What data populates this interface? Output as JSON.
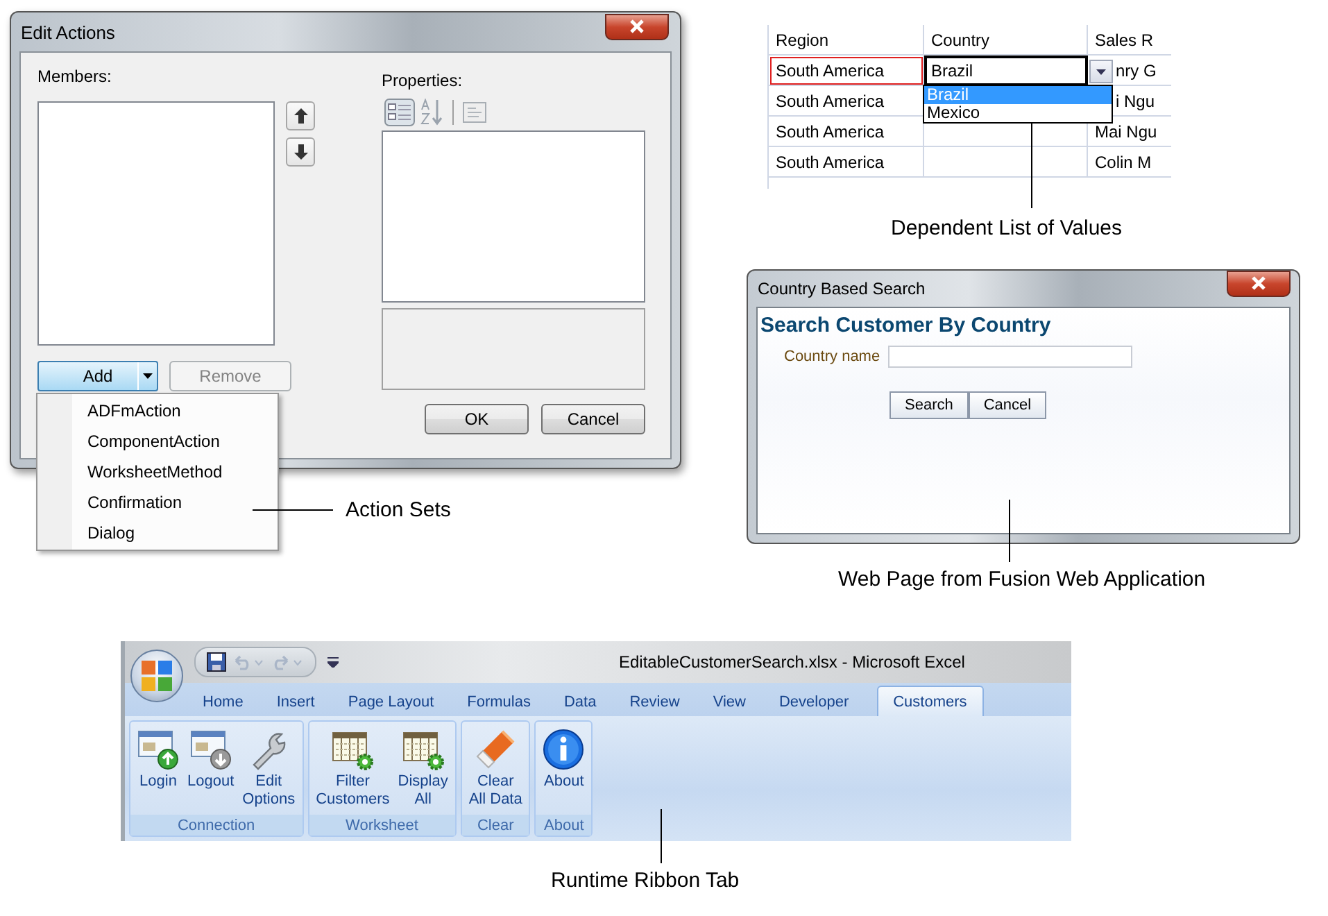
{
  "edit_actions": {
    "title": "Edit Actions",
    "members_label": "Members:",
    "properties_label": "Properties:",
    "add_button": "Add",
    "remove_button": {
      "label": "Remove",
      "disabled": true
    },
    "ok_button": "OK",
    "cancel_button": "Cancel",
    "menu": [
      {
        "label": "ADFmAction"
      },
      {
        "label": "ComponentAction"
      },
      {
        "label": "WorksheetMethod"
      },
      {
        "label": "Confirmation"
      },
      {
        "label": "Dialog"
      }
    ],
    "callout": "Action Sets"
  },
  "grid": {
    "columns": [
      "Region",
      "Country",
      "Sales R"
    ],
    "rows": [
      {
        "region": "South America",
        "country": "Brazil",
        "sales_rep": "nry G",
        "region_marked": true,
        "country_editing": true
      },
      {
        "region": "South America",
        "country": "",
        "sales_rep": "i Ngu",
        "region_marked": false,
        "country_editing": false
      },
      {
        "region": "South America",
        "country": "",
        "sales_rep": "Mai Ngu",
        "region_marked": false,
        "country_editing": false
      },
      {
        "region": "South America",
        "country": "",
        "sales_rep": "Colin M",
        "region_marked": false,
        "country_editing": false
      }
    ],
    "list_options": [
      {
        "label": "Brazil",
        "selected": true
      },
      {
        "label": "Mexico",
        "selected": false
      }
    ],
    "callout": "Dependent List of Values"
  },
  "search_window": {
    "title": "Country Based Search",
    "heading": "Search Customer By Country",
    "field_label": "Country name",
    "buttons": [
      "Search",
      "Cancel"
    ],
    "callout": "Web Page from Fusion Web Application"
  },
  "excel": {
    "title": "EditableCustomerSearch.xlsx - Microsoft Excel",
    "tabs": [
      {
        "label": "Home",
        "selected": false
      },
      {
        "label": "Insert",
        "selected": false
      },
      {
        "label": "Page Layout",
        "selected": false
      },
      {
        "label": "Formulas",
        "selected": false
      },
      {
        "label": "Data",
        "selected": false
      },
      {
        "label": "Review",
        "selected": false
      },
      {
        "label": "View",
        "selected": false
      },
      {
        "label": "Developer",
        "selected": false
      },
      {
        "label": "Customers",
        "selected": true
      }
    ],
    "groups": [
      {
        "label": "Connection",
        "buttons": [
          {
            "label": "Login",
            "kind": "login"
          },
          {
            "label": "Logout",
            "kind": "logout"
          },
          {
            "label": "Edit\nOptions",
            "kind": "wrench"
          }
        ]
      },
      {
        "label": "Worksheet",
        "buttons": [
          {
            "label": "Filter\nCustomers",
            "kind": "sheet"
          },
          {
            "label": "Display\nAll",
            "kind": "sheet"
          }
        ]
      },
      {
        "label": "Clear",
        "buttons": [
          {
            "label": "Clear\nAll Data",
            "kind": "eraser"
          }
        ]
      },
      {
        "label": "About",
        "buttons": [
          {
            "label": "About",
            "kind": "info"
          }
        ]
      }
    ],
    "callout": "Runtime Ribbon Tab"
  }
}
